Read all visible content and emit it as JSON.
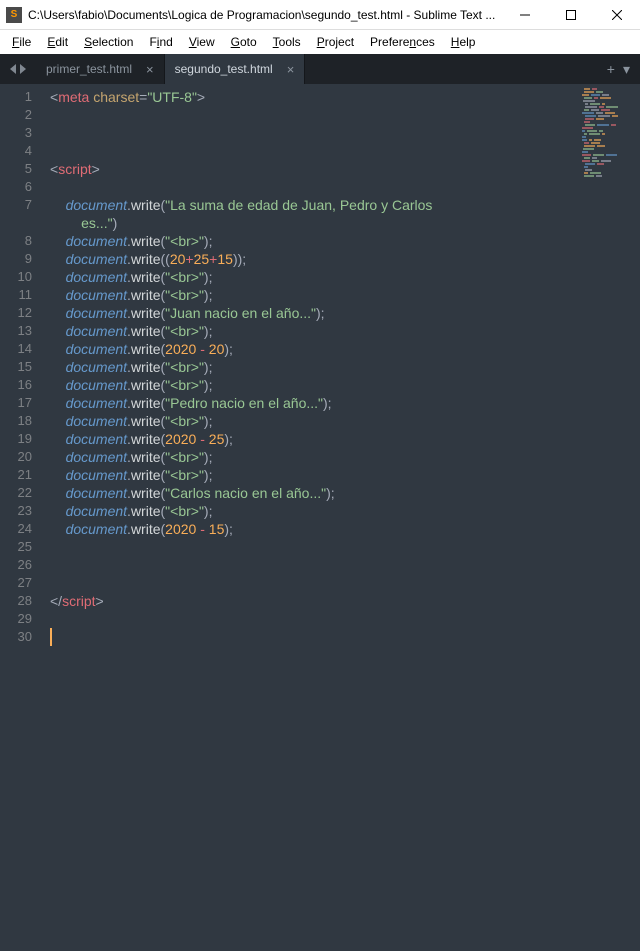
{
  "window": {
    "title": "C:\\Users\\fabio\\Documents\\Logica de Programacion\\segundo_test.html - Sublime Text ..."
  },
  "menu": {
    "items": [
      {
        "u": "F",
        "rest": "ile"
      },
      {
        "u": "E",
        "rest": "dit"
      },
      {
        "u": "S",
        "rest": "election"
      },
      {
        "u": "",
        "rest": "F",
        "u2": "i",
        "rest2": "nd"
      },
      {
        "u": "V",
        "rest": "iew"
      },
      {
        "u": "G",
        "rest": "oto"
      },
      {
        "u": "T",
        "rest": "ools"
      },
      {
        "u": "P",
        "rest": "roject"
      },
      {
        "u": "",
        "rest": "Prefere",
        "u2": "n",
        "rest2": "ces"
      },
      {
        "u": "H",
        "rest": "elp"
      }
    ]
  },
  "tabs": {
    "items": [
      {
        "label": "primer_test.html",
        "active": false
      },
      {
        "label": "segundo_test.html",
        "active": true
      }
    ],
    "plus": "+",
    "down": "▾"
  },
  "code": {
    "lines": [
      {
        "n": 1,
        "html": "<span class='p'>&lt;</span><span class='tg'>meta</span> <span class='at'>charset</span><span class='p'>=</span><span class='st'>\"UTF-8\"</span><span class='p'>&gt;</span>"
      },
      {
        "n": 2,
        "html": ""
      },
      {
        "n": 3,
        "html": ""
      },
      {
        "n": 4,
        "html": ""
      },
      {
        "n": 5,
        "html": "<span class='p'>&lt;</span><span class='tg'>script</span><span class='p'>&gt;</span>"
      },
      {
        "n": 6,
        "html": ""
      },
      {
        "n": 7,
        "html": "    <span class='vr'>document</span><span class='p'>.</span><span class='mt'>write</span><span class='p'>(</span><span class='st'>\"La suma de edad de Juan, Pedro y Carlos</span>"
      },
      {
        "n": "",
        "html": "        <span class='st'>es...\"</span><span class='p'>)</span>"
      },
      {
        "n": 8,
        "html": "    <span class='vr'>document</span><span class='p'>.</span><span class='mt'>write</span><span class='p'>(</span><span class='st'>\"&lt;br&gt;\"</span><span class='p'>)</span><span class='semi'>;</span>"
      },
      {
        "n": 9,
        "html": "    <span class='vr'>document</span><span class='p'>.</span><span class='mt'>write</span><span class='p'>((</span><span class='nm'>20</span><span class='op'>+</span><span class='nm'>25</span><span class='op'>+</span><span class='nm'>15</span><span class='p'>))</span><span class='semi'>;</span>"
      },
      {
        "n": 10,
        "html": "    <span class='vr'>document</span><span class='p'>.</span><span class='mt'>write</span><span class='p'>(</span><span class='st'>\"&lt;br&gt;\"</span><span class='p'>)</span><span class='semi'>;</span>"
      },
      {
        "n": 11,
        "html": "    <span class='vr'>document</span><span class='p'>.</span><span class='mt'>write</span><span class='p'>(</span><span class='st'>\"&lt;br&gt;\"</span><span class='p'>)</span><span class='semi'>;</span>"
      },
      {
        "n": 12,
        "html": "    <span class='vr'>document</span><span class='p'>.</span><span class='mt'>write</span><span class='p'>(</span><span class='st'>\"Juan nacio en el año...\"</span><span class='p'>)</span><span class='semi'>;</span>"
      },
      {
        "n": 13,
        "html": "    <span class='vr'>document</span><span class='p'>.</span><span class='mt'>write</span><span class='p'>(</span><span class='st'>\"&lt;br&gt;\"</span><span class='p'>)</span><span class='semi'>;</span>"
      },
      {
        "n": 14,
        "html": "    <span class='vr'>document</span><span class='p'>.</span><span class='mt'>write</span><span class='p'>(</span><span class='nm'>2020</span> <span class='op'>-</span> <span class='nm'>20</span><span class='p'>)</span><span class='semi'>;</span>"
      },
      {
        "n": 15,
        "html": "    <span class='vr'>document</span><span class='p'>.</span><span class='mt'>write</span><span class='p'>(</span><span class='st'>\"&lt;br&gt;\"</span><span class='p'>)</span><span class='semi'>;</span>"
      },
      {
        "n": 16,
        "html": "    <span class='vr'>document</span><span class='p'>.</span><span class='mt'>write</span><span class='p'>(</span><span class='st'>\"&lt;br&gt;\"</span><span class='p'>)</span><span class='semi'>;</span>"
      },
      {
        "n": 17,
        "html": "    <span class='vr'>document</span><span class='p'>.</span><span class='mt'>write</span><span class='p'>(</span><span class='st'>\"Pedro nacio en el año...\"</span><span class='p'>)</span><span class='semi'>;</span>"
      },
      {
        "n": 18,
        "html": "    <span class='vr'>document</span><span class='p'>.</span><span class='mt'>write</span><span class='p'>(</span><span class='st'>\"&lt;br&gt;\"</span><span class='p'>)</span><span class='semi'>;</span>"
      },
      {
        "n": 19,
        "html": "    <span class='vr'>document</span><span class='p'>.</span><span class='mt'>write</span><span class='p'>(</span><span class='nm'>2020</span> <span class='op'>-</span> <span class='nm'>25</span><span class='p'>)</span><span class='semi'>;</span>"
      },
      {
        "n": 20,
        "html": "    <span class='vr'>document</span><span class='p'>.</span><span class='mt'>write</span><span class='p'>(</span><span class='st'>\"&lt;br&gt;\"</span><span class='p'>)</span><span class='semi'>;</span>"
      },
      {
        "n": 21,
        "html": "    <span class='vr'>document</span><span class='p'>.</span><span class='mt'>write</span><span class='p'>(</span><span class='st'>\"&lt;br&gt;\"</span><span class='p'>)</span><span class='semi'>;</span>"
      },
      {
        "n": 22,
        "html": "    <span class='vr'>document</span><span class='p'>.</span><span class='mt'>write</span><span class='p'>(</span><span class='st'>\"Carlos nacio en el año...\"</span><span class='p'>)</span><span class='semi'>;</span>"
      },
      {
        "n": 23,
        "html": "    <span class='vr'>document</span><span class='p'>.</span><span class='mt'>write</span><span class='p'>(</span><span class='st'>\"&lt;br&gt;\"</span><span class='p'>)</span><span class='semi'>;</span>"
      },
      {
        "n": 24,
        "html": "    <span class='vr'>document</span><span class='p'>.</span><span class='mt'>write</span><span class='p'>(</span><span class='nm'>2020</span> <span class='op'>-</span> <span class='nm'>15</span><span class='p'>)</span><span class='semi'>;</span>"
      },
      {
        "n": 25,
        "html": ""
      },
      {
        "n": 26,
        "html": ""
      },
      {
        "n": 27,
        "html": ""
      },
      {
        "n": 28,
        "html": "<span class='p'>&lt;/</span><span class='tg'>script</span><span class='p'>&gt;</span>"
      },
      {
        "n": 29,
        "html": ""
      },
      {
        "n": 30,
        "html": ""
      }
    ]
  }
}
